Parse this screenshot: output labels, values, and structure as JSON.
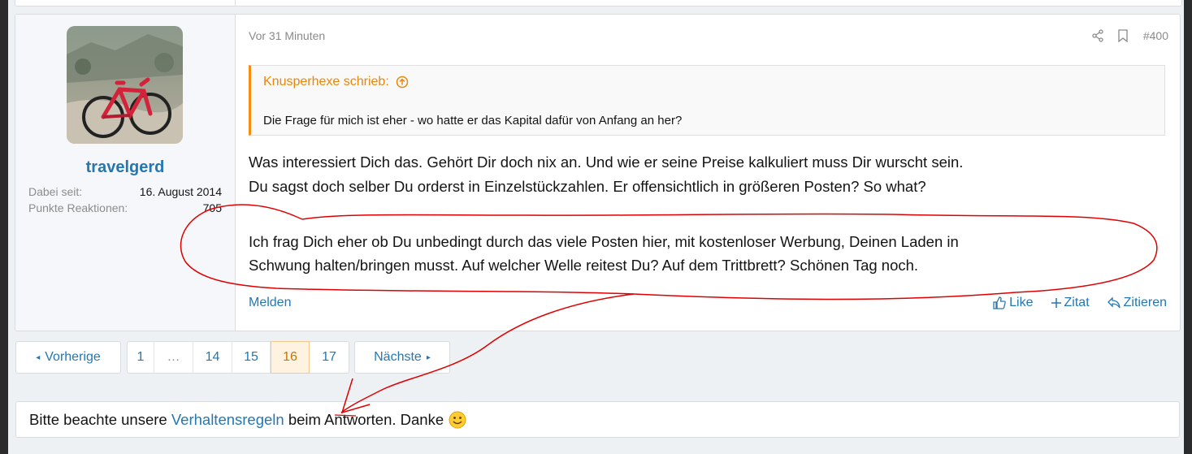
{
  "post": {
    "date": "Vor 31 Minuten",
    "number": "#400",
    "author": {
      "username": "travelgerd",
      "stats": [
        {
          "label": "Dabei seit:",
          "value": "16. August 2014"
        },
        {
          "label": "Punkte Reaktionen:",
          "value": "705"
        }
      ]
    },
    "quote": {
      "author_text": "Knusperhexe schrieb:",
      "text": "Die Frage für mich ist eher - wo hatte er das Kapital dafür von Anfang an her?"
    },
    "body_lines": [
      "Was interessiert Dich das. Gehört Dir doch nix an. Und wie er seine Preise kalkuliert muss Dir wurscht sein.",
      "Du sagst doch selber Du orderst in Einzelstückzahlen. Er offensichtlich in größeren Posten? So what?",
      "Ich frag Dich eher ob Du unbedingt durch das viele Posten hier, mit kostenloser Werbung, Deinen Laden in",
      "Schwung halten/bringen musst. Auf welcher Welle reitest Du? Auf dem Trittbrett? Schönen Tag noch."
    ],
    "footer": {
      "report": "Melden",
      "like": "Like",
      "zitat": "Zitat",
      "zitieren": "Zitieren"
    }
  },
  "pagination": {
    "prev": "Vorherige",
    "next": "Nächste",
    "pages": [
      "1",
      "…",
      "14",
      "15",
      "16",
      "17"
    ],
    "current": "16"
  },
  "notice": {
    "before": "Bitte beachte unsere ",
    "link": "Verhaltensregeln",
    "after": " beim Antworten. Danke"
  },
  "colors": {
    "link": "#2577b1",
    "quote_accent": "#f78c0d",
    "annotation": "#e00000"
  },
  "icons": [
    "share-icon",
    "bookmark-icon",
    "arrow-up-circle-icon",
    "thumbs-up-icon",
    "plus-icon",
    "reply-icon",
    "smiley-icon"
  ]
}
